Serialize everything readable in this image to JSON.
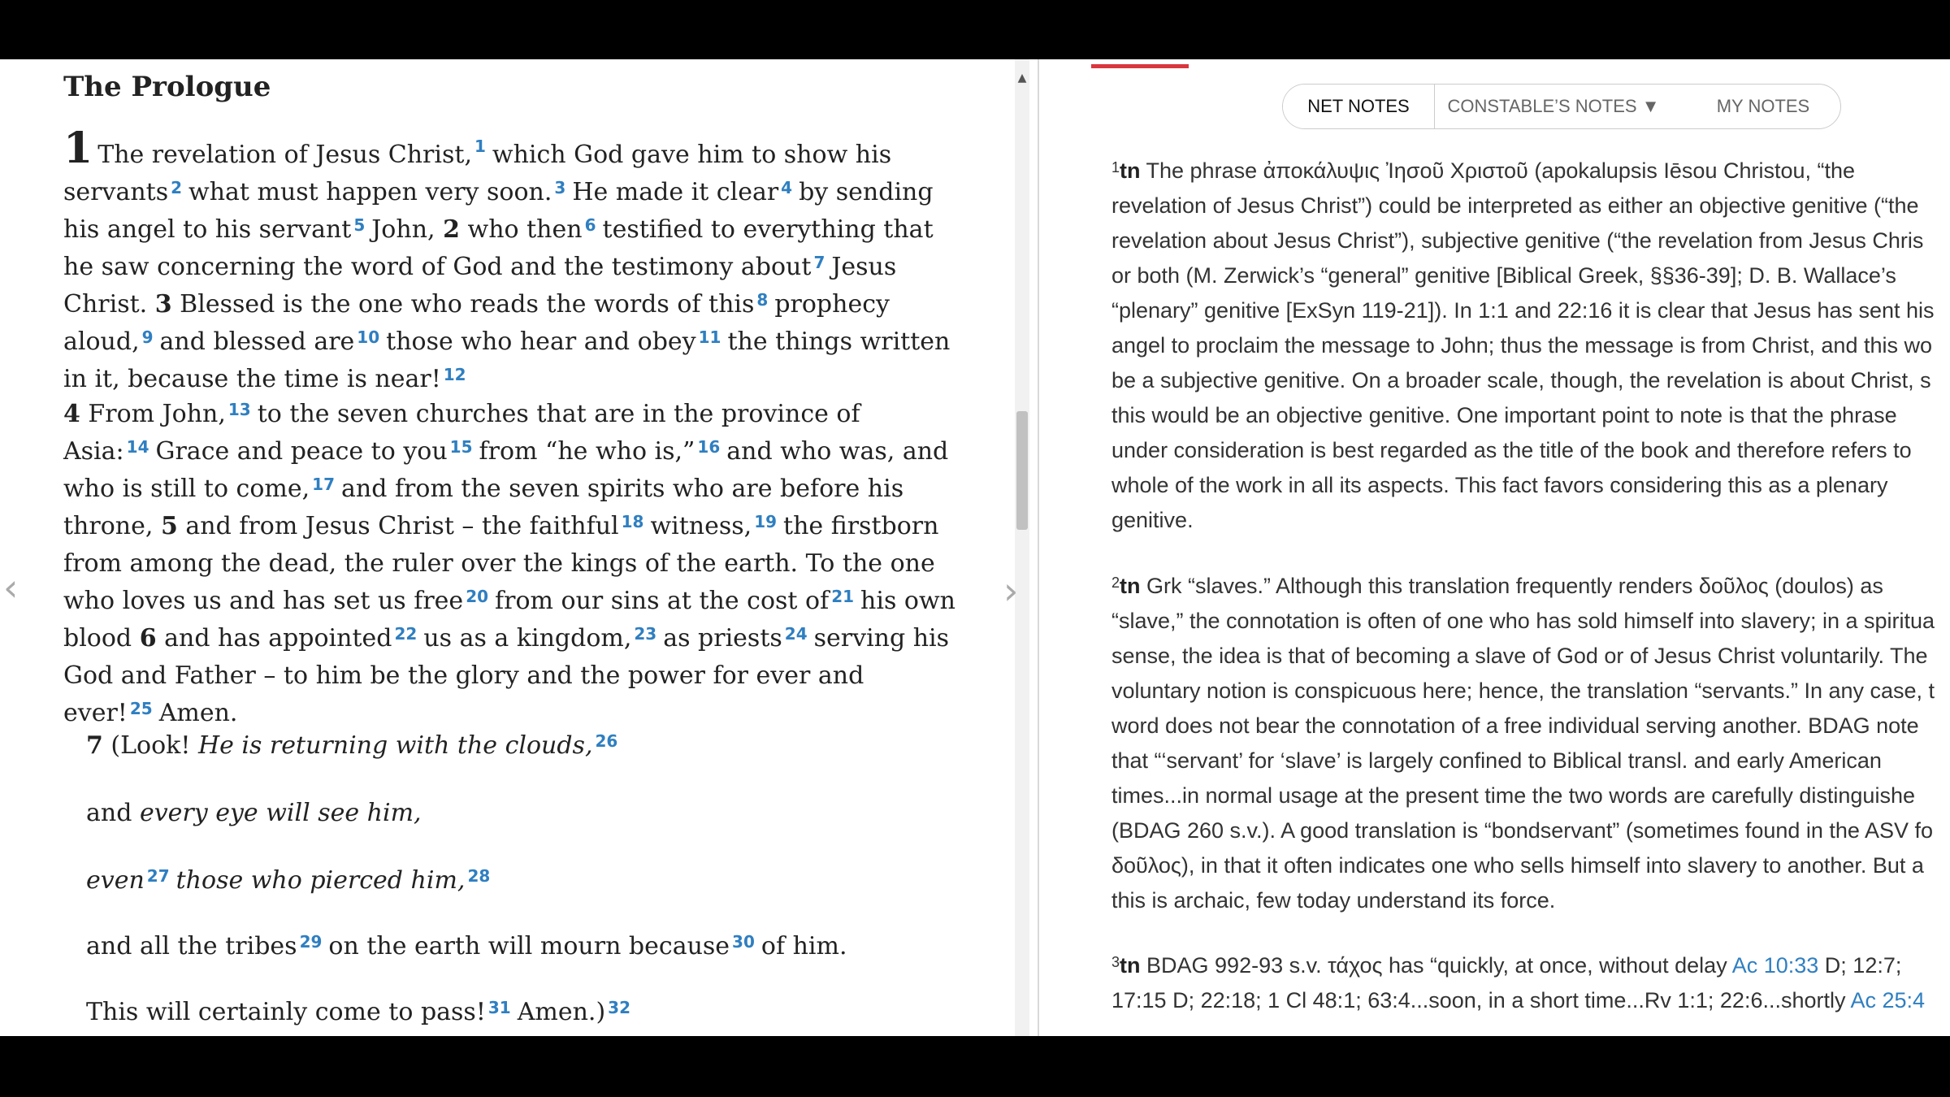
{
  "left": {
    "heading": "The Prologue",
    "chapter_number": "1",
    "fn": [
      "1",
      "2",
      "3",
      "4",
      "5",
      "6",
      "7",
      "8",
      "9",
      "10",
      "11",
      "12",
      "13",
      "14",
      "15",
      "16",
      "17",
      "18",
      "19",
      "20",
      "21",
      "22",
      "23",
      "24",
      "25",
      "26",
      "27",
      "28",
      "29",
      "30",
      "31",
      "32"
    ],
    "vn": [
      "2",
      "3",
      "4",
      "5",
      "6",
      "7"
    ],
    "p1": [
      "The revelation of Jesus Christ,",
      "which God gave him to show his servants",
      "what must happen very soon.",
      "He made it clear",
      "by sending his angel to his servant",
      "John,",
      "who then",
      "testified to everything that he saw concerning the word of God and the testimony about",
      "Jesus Christ.",
      "Blessed is the one who reads the words of this",
      "prophecy aloud,",
      "and blessed are",
      "those who hear and obey",
      "the things written in it, because the time is near!"
    ],
    "p2": [
      "From John,",
      "to the seven churches that are in the province of Asia:",
      "Grace and peace to you",
      "from “he who is,”",
      "and who was, and who is still to come,",
      "and from the seven spirits who are before his throne,",
      "and from Jesus Christ – the faithful",
      "witness,",
      "the firstborn from among the dead, the ruler over the kings of the earth. To the one who loves us and has set us free",
      "from our sins at the cost of",
      "his own blood",
      "and has appointed",
      "us as a kingdom,",
      "as priests",
      "serving his God and Father – to him be the glory and the power for ever and ever!",
      "Amen."
    ],
    "poem": {
      "l1a": "(Look! ",
      "l1b": "He is returning with the clouds,",
      "l2a": "and ",
      "l2b": "every eye will see him,",
      "l3a": "even",
      "l3b": "those who pierced him,",
      "l4a": "and all the tribes",
      "l4b": "on the earth will mourn because",
      "l4c": "of him.",
      "l5a": "This will certainly come to pass!",
      "l5b": "Amen.)"
    }
  },
  "tabs": {
    "net": "NET NOTES",
    "constable": "CONSTABLE’S NOTES ▼",
    "my": "MY NOTES"
  },
  "nav": {
    "prev": "‹",
    "next": "›",
    "scroll_up": "▲"
  },
  "notes": [
    {
      "num": "1",
      "label": "tn",
      "text": "The phrase ἀποκάλυψις Ἰησοῦ Χριστοῦ (apokalupsis Iēsou Christou, “the\nrevelation of Jesus Christ”) could be interpreted as either an objective genitive (“the\nrevelation about Jesus Christ”), subjective genitive (“the revelation from Jesus Chris\nor both (M. Zerwick’s “general” genitive [Biblical Greek, §§36-39]; D. B. Wallace’s\n“plenary” genitive [ExSyn 119-21]). In 1:1 and 22:16 it is clear that Jesus has sent his\nangel to proclaim the message to John; thus the message is from Christ, and this wo\nbe a subjective genitive. On a broader scale, though, the revelation is about Christ, s\nthis would be an objective genitive. One important point to note is that the phrase\nunder consideration is best regarded as the title of the book and therefore refers to\nwhole of the work in all its aspects. This fact favors considering this as a plenary\ngenitive."
    },
    {
      "num": "2",
      "label": "tn",
      "text": "Grk “slaves.” Although this translation frequently renders δοῦλος (doulos) as\n“slave,” the connotation is often of one who has sold himself into slavery; in a spiritua\nsense, the idea is that of becoming a slave of God or of Jesus Christ voluntarily. The\nvoluntary notion is conspicuous here; hence, the translation “servants.” In any case, t\nword does not bear the connotation of a free individual serving another. BDAG note\nthat “‘servant’ for ‘slave’ is largely confined to Biblical transl. and early American\ntimes...in normal usage at the present time the two words are carefully distinguishe\n(BDAG 260 s.v.). A good translation is “bondservant” (sometimes found in the ASV fo\nδοῦλος), in that it often indicates one who sells himself into slavery to another. But a\nthis is archaic, few today understand its force."
    },
    {
      "num": "3",
      "label": "tn",
      "t1": "BDAG 992-93 s.v. τάχος has “quickly, at once, without delay ",
      "link1": "Ac 10:33",
      "t2": " D; 12:7;\n17:15 D; 22:18; 1 Cl 48:1; 63:4...soon, in a short time...Rv 1:1; 22:6...shortly ",
      "link2": "Ac 25:4"
    }
  ]
}
